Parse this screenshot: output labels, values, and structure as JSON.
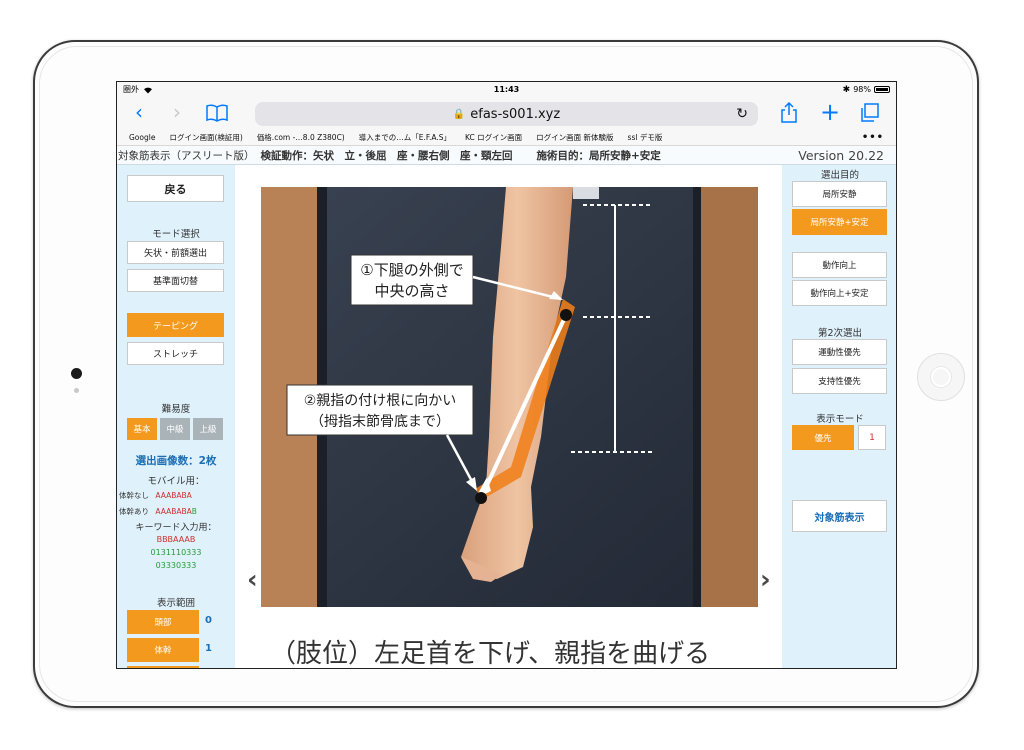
{
  "status": {
    "carrier": "圏外",
    "time": "11:43",
    "battery": "98%"
  },
  "browser": {
    "url": "efas-s001.xyz",
    "bookmarks": [
      "Google",
      "ログイン画面(検証用)",
      "価格.com -…8.0 Z380C)",
      "導入までの…ム「E.F.A.S」",
      "KC ログイン画面",
      "ログイン画面 新体験版",
      "ssl デモ版"
    ],
    "more": "•••"
  },
  "header": {
    "title": "対象筋表示（アスリート版）",
    "motion": "検証動作：矢状　立・後屈　座・腰右側　座・頸左回",
    "purpose": "施術目的：局所安静+安定",
    "version": "Version 20.22"
  },
  "left": {
    "back": "戻る",
    "mode_label": "モード選択",
    "mode_btn1": "矢状・前額選出",
    "mode_btn2": "基準面切替",
    "taping": "テーピング",
    "stretch": "ストレッチ",
    "difficulty_label": "難易度",
    "level_basic": "基本",
    "level_mid": "中級",
    "level_high": "上級",
    "image_count": "選出画像数：2枚",
    "mobile_label": "モバイル用：",
    "trunk_none_label": "体幹なし",
    "trunk_none_code": "AAABABA",
    "trunk_yes_label": "体幹あり",
    "trunk_yes_code": "AAABABA",
    "trunk_yes_code_suffix": "B",
    "keyword_label": "キーワード入力用：",
    "kw1": "BBBAAAB",
    "kw2": "0131110333",
    "kw3": "03330333",
    "range_label": "表示範囲",
    "range_head": "頭部",
    "range_head_count": "0",
    "range_trunk": "体幹",
    "range_trunk_count": "1"
  },
  "center": {
    "note1_line1": "①下腿の外側で",
    "note1_line2": "中央の高さ",
    "note2_line1": "②親指の付け根に向かい",
    "note2_line2": "（拇指末節骨底まで）",
    "caption": "（肢位）左足首を下げ、親指を曲げる"
  },
  "right": {
    "purpose_label": "選出目的",
    "btn_rest": "局所安静",
    "btn_rest_stable": "局所安静+安定",
    "btn_improve": "動作向上",
    "btn_improve_stable": "動作向上+安定",
    "secondary_label": "第2次選出",
    "btn_mobility": "運動性優先",
    "btn_support": "支持性優先",
    "display_mode_label": "表示モード",
    "btn_priority": "優先",
    "priority_value": "1",
    "btn_target": "対象筋表示"
  },
  "colors": {
    "accent_orange": "#f39a1e",
    "panel_blue": "#dff1fb",
    "ios_blue": "#007aff",
    "code_red": "#d0312d",
    "code_green": "#2a9a3c",
    "link_blue": "#1b6fb8"
  }
}
